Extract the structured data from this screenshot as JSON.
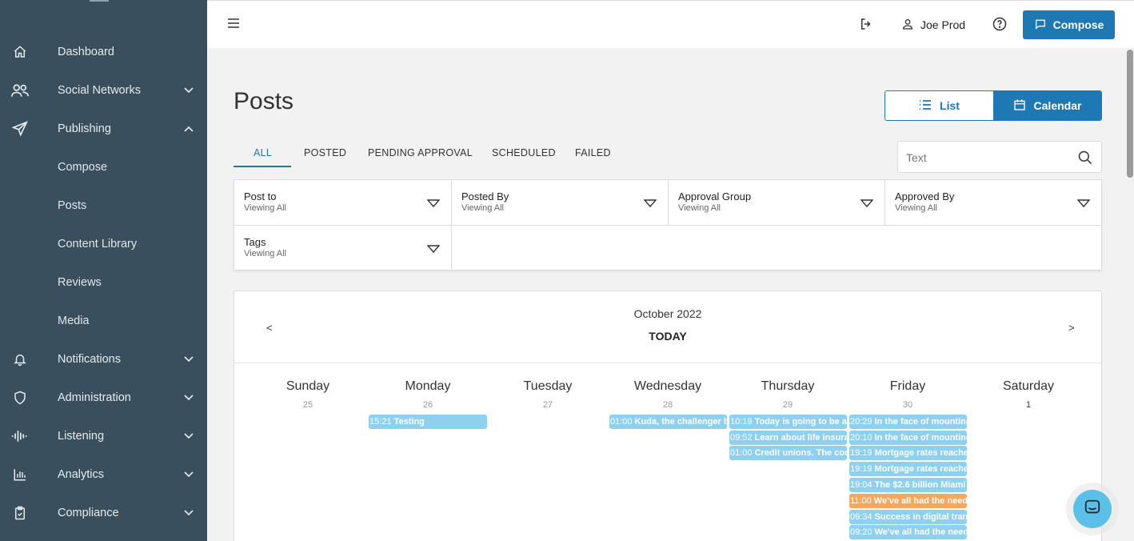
{
  "sidebar": {
    "items": [
      {
        "label": "Dashboard"
      },
      {
        "label": "Social Networks"
      },
      {
        "label": "Publishing"
      },
      {
        "label": "Notifications"
      },
      {
        "label": "Administration"
      },
      {
        "label": "Listening"
      },
      {
        "label": "Analytics"
      },
      {
        "label": "Compliance"
      }
    ],
    "publishing_sub": [
      {
        "label": "Compose"
      },
      {
        "label": "Posts"
      },
      {
        "label": "Content Library"
      },
      {
        "label": "Reviews"
      },
      {
        "label": "Media"
      }
    ]
  },
  "header": {
    "user_name": "Joe Prod",
    "compose_label": "Compose"
  },
  "page": {
    "title": "Posts",
    "view_list": "List",
    "view_calendar": "Calendar"
  },
  "tabs": [
    {
      "label": "ALL"
    },
    {
      "label": "POSTED"
    },
    {
      "label": "PENDING APPROVAL"
    },
    {
      "label": "SCHEDULED"
    },
    {
      "label": "FAILED"
    }
  ],
  "search": {
    "placeholder": "Text"
  },
  "filters": [
    {
      "title": "Post to",
      "value": "Viewing All"
    },
    {
      "title": "Posted By",
      "value": "Viewing All"
    },
    {
      "title": "Approval Group",
      "value": "Viewing All"
    },
    {
      "title": "Approved By",
      "value": "Viewing All"
    },
    {
      "title": "Tags",
      "value": "Viewing All"
    }
  ],
  "calendar": {
    "month": "October 2022",
    "today": "TODAY",
    "prev": "<",
    "next": ">",
    "days": [
      {
        "name": "Sunday",
        "num": "25"
      },
      {
        "name": "Monday",
        "num": "26"
      },
      {
        "name": "Tuesday",
        "num": "27"
      },
      {
        "name": "Wednesday",
        "num": "28"
      },
      {
        "name": "Thursday",
        "num": "29"
      },
      {
        "name": "Friday",
        "num": "30"
      },
      {
        "name": "Saturday",
        "num": "1"
      }
    ],
    "events": {
      "monday": [
        {
          "time": "15:21",
          "text": "Testing"
        }
      ],
      "wednesday": [
        {
          "time": "01:00",
          "text": "Kuda, the challenger b"
        }
      ],
      "thursday": [
        {
          "time": "10:19",
          "text": "Today is going to be a"
        },
        {
          "time": "09:52",
          "text": "Learn about life insura"
        },
        {
          "time": "01:00",
          "text": "Credit unions. The coo"
        }
      ],
      "friday": [
        {
          "time": "20:29",
          "text": "In the face of mounting"
        },
        {
          "time": "20:10",
          "text": "In the face of mounting"
        },
        {
          "time": "19:19",
          "text": "Mortgage rates reache"
        },
        {
          "time": "19:19",
          "text": "Mortgage rates reache"
        },
        {
          "time": "19:04",
          "text": "The $2.6 billion Miami"
        },
        {
          "time": "11:00",
          "text": "We've all had the need"
        },
        {
          "time": "09:34",
          "text": "Success in digital trans"
        },
        {
          "time": "09:20",
          "text": "We've all had the need"
        }
      ]
    }
  },
  "colors": {
    "sidebar": "#3a4f5e",
    "accent": "#1e78b4",
    "event_blue": "#8fd0ef",
    "event_orange": "#f4a85f"
  }
}
